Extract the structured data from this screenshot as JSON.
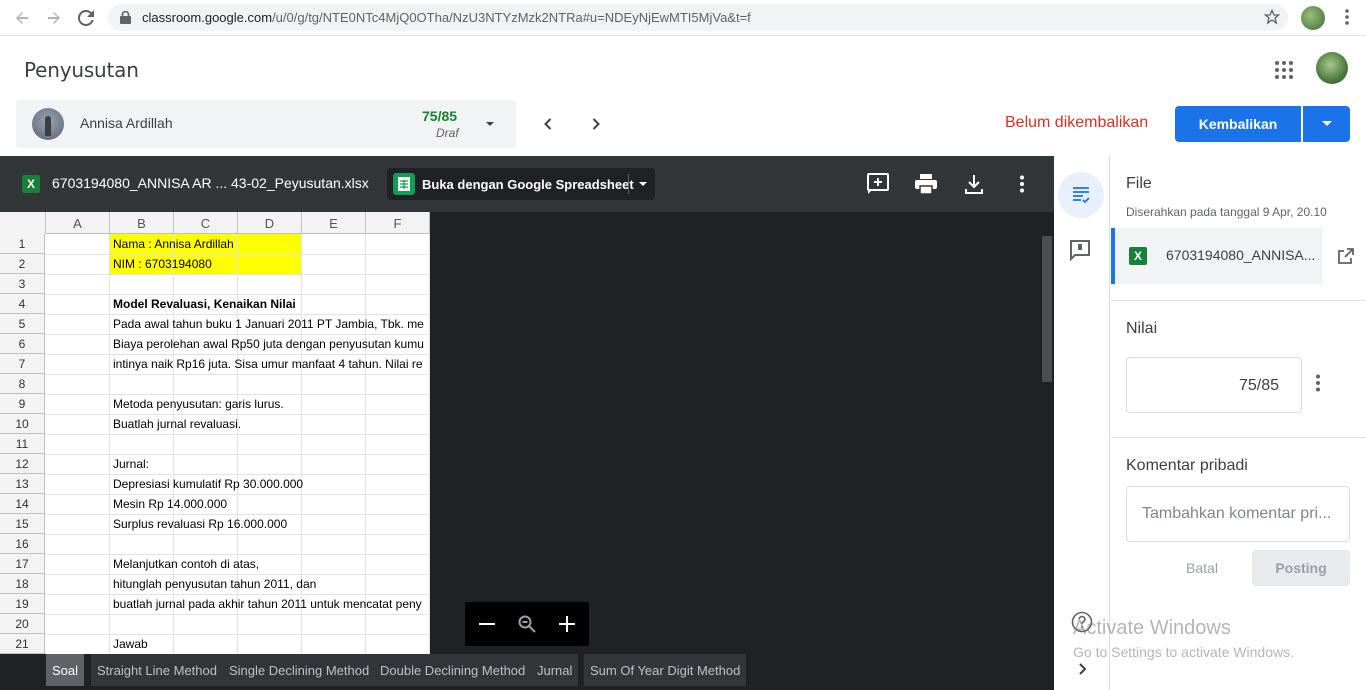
{
  "browser": {
    "url_host": "classroom.google.com",
    "url_path": "/u/0/g/tg/NTE0NTc4MjQ0OTha/NzU3NTYzMzk2NTRa#u=NDEyNjEwMTI5MjVa&t=f"
  },
  "app": {
    "title": "Penyusutan"
  },
  "student": {
    "name": "Annisa Ardillah",
    "grade": "75/85",
    "status": "Draf"
  },
  "header": {
    "status_text": "Belum dikembalikan",
    "return_label": "Kembalikan"
  },
  "viewer": {
    "file_title": "6703194080_ANNISA AR ... 43-02_Peyusutan.xlsx",
    "open_with_label": "Buka dengan Google Spreadsheet",
    "xls_glyph": "X",
    "columns": [
      "A",
      "B",
      "C",
      "D",
      "E",
      "F"
    ],
    "rows": [
      "1",
      "2",
      "3",
      "4",
      "5",
      "6",
      "7",
      "8",
      "9",
      "10",
      "11",
      "12",
      "13",
      "14",
      "15",
      "16",
      "17",
      "18",
      "19",
      "20",
      "21"
    ],
    "cells": {
      "r1": "Nama : Annisa Ardillah",
      "r2": "NIM : 6703194080",
      "r4": "Model Revaluasi, Kenaikan Nilai",
      "r5": "Pada awal tahun buku 1 Januari 2011 PT Jambia, Tbk. me",
      "r6": "Biaya perolehan awal Rp50 juta dengan penyusutan kumu",
      "r7": "intinya naik Rp16 juta. Sisa umur manfaat 4 tahun. Nilai re",
      "r9": "Metoda penyusutan: garis lurus.",
      "r10": "Buatlah jurnal revaluasi.",
      "r12": "Jurnal:",
      "r13": "Depresiasi kumulatif Rp 30.000.000",
      "r14": "Mesin Rp 14.000.000",
      "r15": "Surplus revaluasi Rp 16.000.000",
      "r17": "Melanjutkan contoh di atas,",
      "r18": "hitunglah penyusutan tahun 2011, dan",
      "r19": "buatlah jurnal pada akhir tahun 2011 untuk mencatat peny",
      "r21": "Jawab"
    },
    "sheet_tabs": [
      "Soal",
      "Straight Line Method",
      "Single Declining Method",
      "Double Declining Method",
      "Jurnal",
      "Sum Of Year Digit Method"
    ],
    "active_tab": "Soal"
  },
  "panel": {
    "file_heading": "File",
    "submitted_text": "Diserahkan pada tanggal 9 Apr, 20.10",
    "file_name": "6703194080_ANNISA...",
    "grade_heading": "Nilai",
    "grade_value": "75/85",
    "comment_heading": "Komentar pribadi",
    "comment_placeholder": "Tambahkan komentar pri...",
    "cancel_label": "Batal",
    "post_label": "Posting"
  },
  "watermark": {
    "line1": "Activate Windows",
    "line2": "Go to Settings to activate Windows."
  },
  "colors": {
    "primary": "#1a73e8",
    "danger": "#d93025",
    "grade_green": "#188038",
    "sheets_green": "#0f9d58",
    "highlight_yellow": "#ffff00"
  }
}
